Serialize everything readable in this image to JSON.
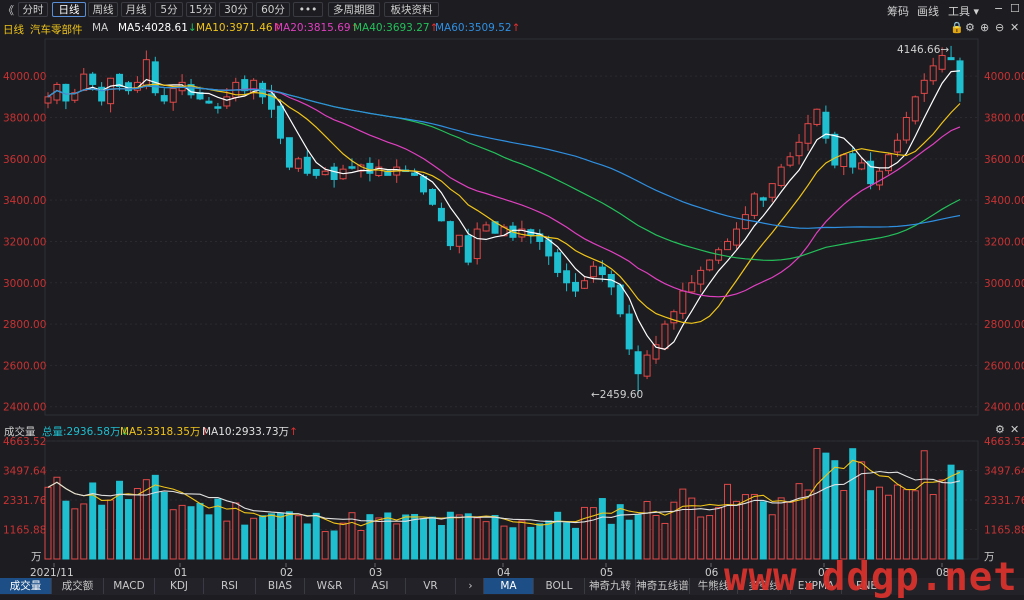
{
  "toolbar": {
    "back": "《",
    "periods": [
      "分时",
      "日线",
      "周线",
      "月线",
      "5分",
      "15分",
      "30分",
      "60分",
      "•••",
      "多周期图",
      "板块资料"
    ],
    "active_index": 1,
    "right": [
      "筹码",
      "画线",
      "工具 ▾"
    ]
  },
  "main": {
    "period_label": "日线",
    "stock_name": "汽车零部件",
    "indicator": "MA",
    "ma": [
      {
        "label": "MA5:4028.61",
        "arrow": "↓",
        "color": "#ffffff"
      },
      {
        "label": "MA10:3971.46",
        "arrow": "↑",
        "color": "#f0c419"
      },
      {
        "label": "MA20:3815.69",
        "arrow": "↑",
        "color": "#e040c0"
      },
      {
        "label": "MA40:3693.27",
        "arrow": "↑",
        "color": "#24c05a"
      },
      {
        "label": "MA60:3509.52",
        "arrow": "↑",
        "color": "#2f8fe0"
      }
    ],
    "high_label": "4146.66→",
    "low_label": "←2459.60"
  },
  "volume": {
    "title": "成交量",
    "total": "总量:2936.58万",
    "total_arrow": "↓",
    "ma5": "MA5:3318.35万",
    "ma5_arrow": "↑",
    "ma10": "MA10:2933.73万",
    "ma10_arrow": "↑",
    "unit": "万"
  },
  "chart_data": [
    {
      "type": "candlestick",
      "yticks": [
        "4000.00",
        "3800.00",
        "3600.00",
        "3400.00",
        "3200.00",
        "3000.00",
        "2800.00",
        "2600.00",
        "2400.00"
      ],
      "ylim": [
        2360,
        4180
      ],
      "xticks": [
        "2021/11",
        "01",
        "02",
        "03",
        "04",
        "05",
        "06",
        "07",
        "08"
      ],
      "high": 4146.66,
      "low": 2459.6,
      "close_path": [
        3900,
        3960,
        3880,
        3920,
        4010,
        3960,
        3880,
        3990,
        3950,
        3930,
        3970,
        4080,
        3920,
        3880,
        3940,
        3970,
        3910,
        3890,
        3870,
        3850,
        3900,
        3970,
        3930,
        3980,
        3900,
        3840,
        3700,
        3560,
        3600,
        3530,
        3520,
        3540,
        3500,
        3550,
        3560,
        3570,
        3530,
        3560,
        3520,
        3560,
        3540,
        3520,
        3440,
        3380,
        3300,
        3180,
        3230,
        3100,
        3260,
        3280,
        3240,
        3270,
        3220,
        3260,
        3230,
        3200,
        3130,
        3050,
        3000,
        2960,
        3010,
        3080,
        3040,
        2980,
        2850,
        2680,
        2560,
        2650,
        2700,
        2800,
        2860,
        2960,
        3000,
        3060,
        3110,
        3160,
        3200,
        3260,
        3330,
        3430,
        3400,
        3480,
        3560,
        3610,
        3680,
        3770,
        3840,
        3700,
        3570,
        3620,
        3560,
        3580,
        3480,
        3540,
        3620,
        3690,
        3800,
        3900,
        3980,
        4050,
        4100,
        4080,
        3920
      ]
    },
    {
      "type": "bar",
      "yticks": [
        "4663.52",
        "3497.64",
        "2331.76",
        "1165.88"
      ],
      "ylim": [
        0,
        4663.52
      ]
    }
  ],
  "bottom_tabs": {
    "left": [
      "成交量",
      "成交额",
      "MACD",
      "KDJ",
      "RSI",
      "BIAS",
      "W&R",
      "ASI",
      "VR"
    ],
    "left_active": 0,
    "right": [
      "MA",
      "BOLL",
      "神奇九转",
      "神奇五线谱",
      "牛熊线",
      "多空线",
      "EXPMA",
      "ENE"
    ],
    "right_active": 0
  },
  "watermark": "www.ddgp.net"
}
